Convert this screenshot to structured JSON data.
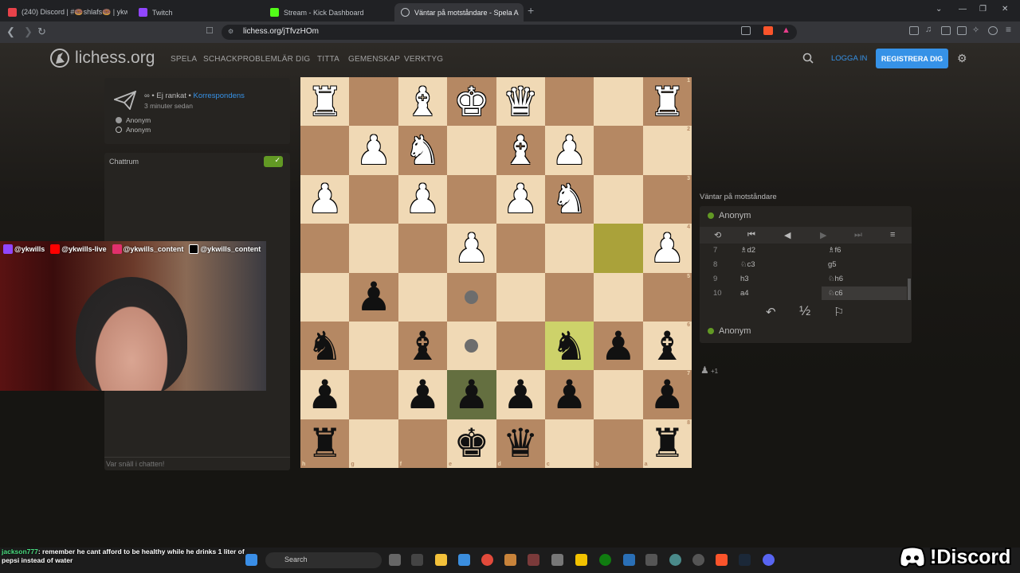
{
  "browser": {
    "tabs": [
      {
        "label": "(240) Discord | #🍩shlafs🍩 | ykwill",
        "icon_color": "#e8424a"
      },
      {
        "label": "Twitch",
        "icon_color": "#9146ff"
      },
      {
        "label": "Stream - Kick Dashboard",
        "icon_color": "#53fc18"
      },
      {
        "label": "Väntar på motståndare - Spela A",
        "icon_color": "#bdc1c6"
      }
    ],
    "url": "lichess.org/jTfvzHOm"
  },
  "site": {
    "logo_text": "lichess.org",
    "menu": [
      "SPELA",
      "SCHACKPROBLEM",
      "LÄR DIG",
      "TITTA",
      "GEMENSKAP",
      "VERKTYG"
    ],
    "login": "LOGGA IN",
    "register": "REGISTRERA DIG"
  },
  "game_info": {
    "meta_prefix": "∞ • Ej rankat • ",
    "meta_link": "Korrespondens",
    "time": "3 minuter sedan",
    "players": [
      "Anonym",
      "Anonym"
    ]
  },
  "chat": {
    "title": "Chattrum",
    "toggle_icon": "✓",
    "placeholder": "Var snäll i chatten!"
  },
  "board": {
    "light": "#f0d9b5",
    "dark": "#b58863",
    "rows": [
      [
        "R",
        "",
        "B",
        "K",
        "Q",
        "",
        "",
        "R"
      ],
      [
        "",
        "P",
        "N",
        "",
        "B",
        "P",
        "",
        ""
      ],
      [
        "P",
        "",
        "P",
        "",
        "P",
        "N",
        "",
        ""
      ],
      [
        "",
        "",
        "",
        "P",
        "",
        "",
        "",
        "P"
      ],
      [
        "",
        "p",
        "",
        "",
        "",
        "",
        "",
        ""
      ],
      [
        "n",
        "",
        "b",
        "",
        "",
        "n",
        "p",
        "b"
      ],
      [
        "p",
        "",
        "p",
        "p",
        "p",
        "p",
        "",
        "p"
      ],
      [
        "r",
        "",
        "",
        "k",
        "q",
        "",
        "",
        "r"
      ]
    ],
    "highlights": [
      {
        "r": 3,
        "c": 6,
        "type": "hl"
      },
      {
        "r": 5,
        "c": 5,
        "type": "hl"
      },
      {
        "r": 6,
        "c": 3,
        "type": "sel"
      }
    ],
    "move_dots": [
      {
        "r": 4,
        "c": 3
      },
      {
        "r": 5,
        "c": 3
      }
    ],
    "rank_labels": [
      "1",
      "2",
      "3",
      "4",
      "5",
      "6",
      "7",
      "8"
    ],
    "file_labels": [
      "h",
      "g",
      "f",
      "e",
      "d",
      "c",
      "b",
      "a"
    ]
  },
  "right_panel": {
    "status": "Väntar på motståndare",
    "top_player": "Anonym",
    "bottom_player": "Anonym",
    "moves": [
      {
        "n": "7",
        "w": "♗d2",
        "b": "♗f6"
      },
      {
        "n": "8",
        "w": "♘c3",
        "b": "g5"
      },
      {
        "n": "9",
        "w": "h3",
        "b": "♘h6"
      },
      {
        "n": "10",
        "w": "a4",
        "b": "♘c6"
      }
    ],
    "draw_symbol": "½",
    "spectators": "+1"
  },
  "stream_overlay": {
    "socials": [
      {
        "label": "@ykwills",
        "color": "#9146ff"
      },
      {
        "label": "@ykwills-live",
        "color": "#ff0000"
      },
      {
        "label": "@ykwills_content",
        "color": "#e1306c"
      },
      {
        "label": "@ykwills_content",
        "color": "#000000"
      }
    ],
    "chat_user": "jackson777",
    "chat_msg": ": remember he cant afford to be healthy while he drinks 1 liter of pepsi instead of water",
    "discord_text": "!Discord"
  },
  "taskbar": {
    "search": "Search"
  }
}
